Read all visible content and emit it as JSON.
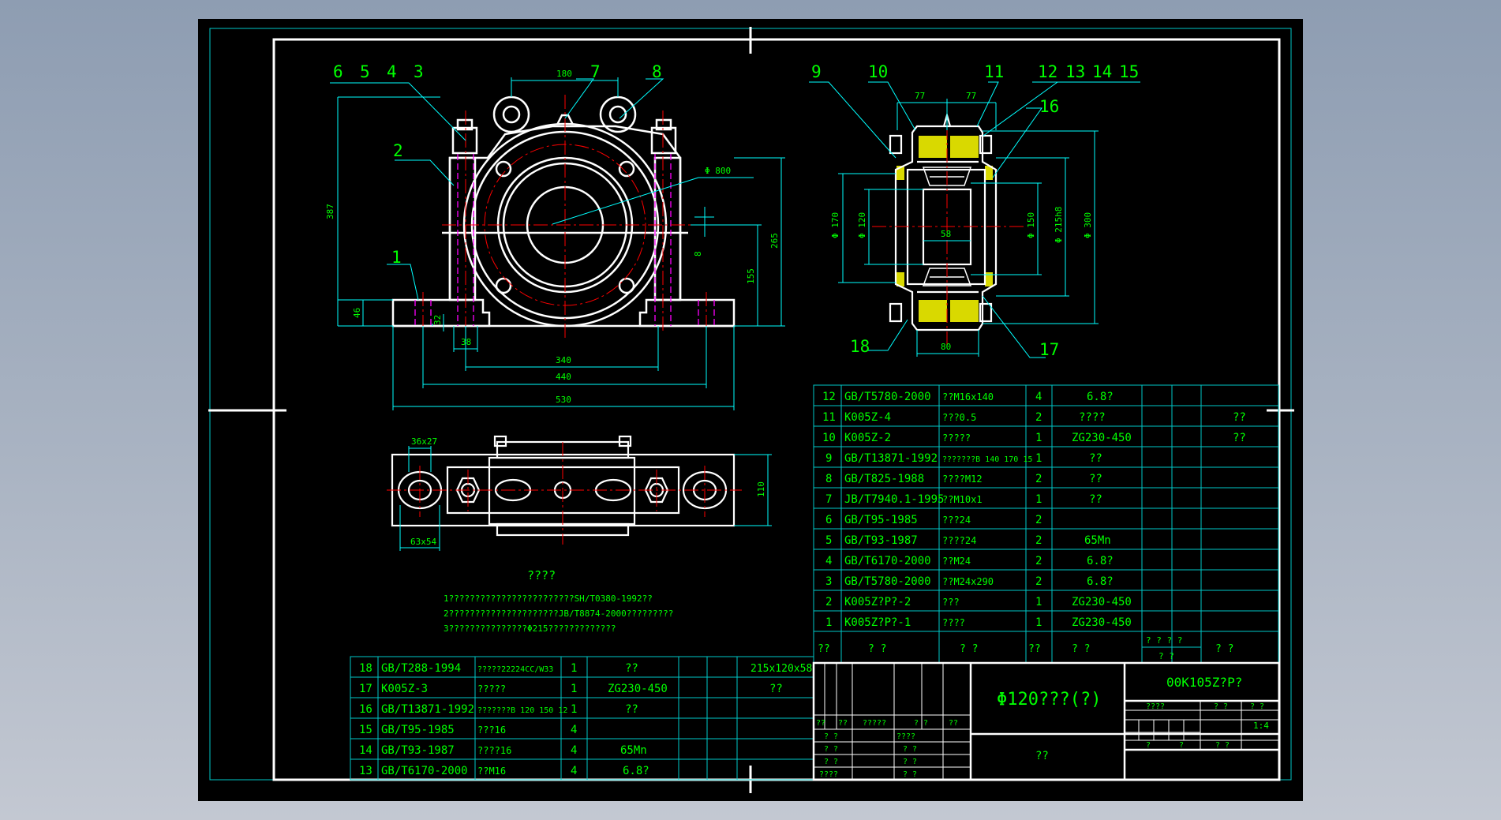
{
  "colors": {
    "background": "#8e9db2",
    "sheet": "#000000",
    "frame": "#ffffff",
    "dimension": "#00ffff",
    "text": "#00ff00",
    "center_line": "#ff0000",
    "hidden_line": "#ff00ff",
    "hatch": "#ffff00"
  },
  "front_view": {
    "labels": [
      "6",
      "5",
      "4",
      "3",
      "7",
      "8",
      "2",
      "1"
    ],
    "dims": {
      "top_span": "180",
      "dia": "Φ 800",
      "height_total": "387",
      "height_right": "265",
      "center_h": "155",
      "base_h": "46",
      "small_v": "8",
      "slot": "32",
      "hole": "38",
      "w340": "340",
      "w440": "440",
      "w530": "530"
    }
  },
  "side_view": {
    "labels": [
      "9",
      "10",
      "11",
      "12",
      "13",
      "14",
      "15",
      "16",
      "17",
      "18"
    ],
    "dims": {
      "top_a": "77",
      "top_b": "77",
      "bottom": "80",
      "inner": "58",
      "d170": "Φ 170",
      "d120": "Φ 120",
      "d150": "Φ 150",
      "d215": "Φ 215h8",
      "d300": "Φ 300"
    }
  },
  "plan_view": {
    "dims": {
      "slot_top": "36x27",
      "slot_bottom": "63x54",
      "right": "110"
    }
  },
  "notes": {
    "title": "????",
    "lines": [
      "1????????????????????????SH/T0380-1992??",
      "2?????????????????????JB/T8874-2000?????????",
      "3???????????????Φ215?????????????"
    ]
  },
  "bom_right": [
    {
      "no": "12",
      "code": "GB/T5780-2000",
      "name": "??M16x140",
      "qty": "4",
      "mat": "6.8?",
      "note": ""
    },
    {
      "no": "11",
      "code": "K005Z-4",
      "name": "???0.5",
      "qty": "2",
      "mat": "????",
      "note": "??"
    },
    {
      "no": "10",
      "code": "K005Z-2",
      "name": "?????",
      "qty": "1",
      "mat": "ZG230-450",
      "note": "??"
    },
    {
      "no": "9",
      "code": "GB/T13871-1992",
      "name": "???????B 140 170 15",
      "qty": "1",
      "mat": "??",
      "note": ""
    },
    {
      "no": "8",
      "code": "GB/T825-1988",
      "name": "????M12",
      "qty": "2",
      "mat": "??",
      "note": ""
    },
    {
      "no": "7",
      "code": "JB/T7940.1-1995",
      "name": "??M10x1",
      "qty": "1",
      "mat": "??",
      "note": ""
    },
    {
      "no": "6",
      "code": "GB/T95-1985",
      "name": "???24",
      "qty": "2",
      "mat": "",
      "note": ""
    },
    {
      "no": "5",
      "code": "GB/T93-1987",
      "name": "????24",
      "qty": "2",
      "mat": "65Mn",
      "note": ""
    },
    {
      "no": "4",
      "code": "GB/T6170-2000",
      "name": "??M24",
      "qty": "2",
      "mat": "6.8?",
      "note": ""
    },
    {
      "no": "3",
      "code": "GB/T5780-2000",
      "name": "??M24x290",
      "qty": "2",
      "mat": "6.8?",
      "note": ""
    },
    {
      "no": "2",
      "code": "K005Z?P?-2",
      "name": "???",
      "qty": "1",
      "mat": "ZG230-450",
      "note": ""
    },
    {
      "no": "1",
      "code": "K005Z?P?-1",
      "name": "????",
      "qty": "1",
      "mat": "ZG230-450",
      "note": ""
    }
  ],
  "bom_header": [
    "??",
    "?   ?",
    "?   ?",
    "??",
    "?   ?",
    "? ?   ? ?",
    "? ?",
    "?   ?"
  ],
  "bom_left": [
    {
      "no": "18",
      "code": "GB/T288-1994",
      "name": "?????22224CC/W33",
      "qty": "1",
      "mat": "??",
      "note": "215x120x58"
    },
    {
      "no": "17",
      "code": "K005Z-3",
      "name": "?????",
      "qty": "1",
      "mat": "ZG230-450",
      "note": "??"
    },
    {
      "no": "16",
      "code": "GB/T13871-1992",
      "name": "???????B 120 150 12",
      "qty": "1",
      "mat": "??",
      "note": ""
    },
    {
      "no": "15",
      "code": "GB/T95-1985",
      "name": "???16",
      "qty": "4",
      "mat": "",
      "note": ""
    },
    {
      "no": "14",
      "code": "GB/T93-1987",
      "name": "????16",
      "qty": "4",
      "mat": "65Mn",
      "note": ""
    },
    {
      "no": "13",
      "code": "GB/T6170-2000",
      "name": "??M16",
      "qty": "4",
      "mat": "6.8?",
      "note": ""
    }
  ],
  "title_block": {
    "drawing_name": "Φ120???(?)",
    "drawing_no": "00K105Z?P?",
    "unit": "??",
    "small_row": [
      "??",
      "??",
      "?????",
      "? ?",
      "??"
    ],
    "left_rows": [
      "? ?",
      "? ?",
      "? ?",
      "????"
    ],
    "mid_rows": [
      "????",
      "? ?",
      "? ?",
      "? ?"
    ],
    "right_a": [
      "????",
      "? ?",
      "? ?"
    ],
    "scale": "1:4",
    "right_b": [
      "?",
      "?",
      "?   ?"
    ]
  }
}
